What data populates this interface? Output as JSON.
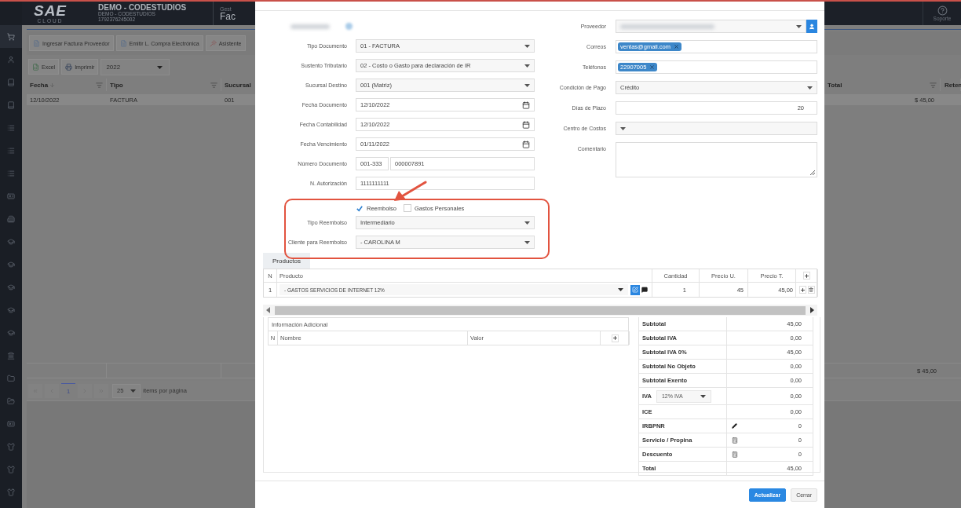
{
  "app": {
    "logo": "SAE",
    "logo_sub": "CLOUD",
    "company": "DEMO - CODESTUDIOS",
    "company_sub": "DEMO - CODESTUDIOS",
    "company_id": "1792376245002",
    "section": "Gest",
    "page_title": "Fac",
    "support": "Soporte"
  },
  "sidebar": {
    "items": [
      {
        "selected": true
      },
      {
        "selected": false
      },
      {
        "selected": false
      },
      {
        "selected": false
      },
      {
        "selected": false
      },
      {
        "selected": false
      },
      {
        "selected": false
      },
      {
        "selected": false
      },
      {
        "selected": false
      },
      {
        "selected": false
      },
      {
        "selected": false
      },
      {
        "selected": false
      },
      {
        "selected": false
      },
      {
        "selected": false
      },
      {
        "selected": false
      },
      {
        "selected": false
      },
      {
        "selected": false
      },
      {
        "selected": false
      },
      {
        "selected": false
      },
      {
        "selected": false
      },
      {
        "selected": false
      }
    ]
  },
  "actions": [
    "Ingresar Factura Proveedor",
    "Emitir L. Compra Electrónica",
    "Asistente"
  ],
  "list_tools": {
    "buttons": [
      "Excel",
      "Imprimir"
    ],
    "year": "2022"
  },
  "grid": {
    "columns": [
      {
        "label": "Fecha",
        "sorted": true
      },
      {
        "label": "Tipo",
        "sorted": false
      },
      {
        "label": "Sucursal",
        "sorted": false
      }
    ],
    "right_columns": [
      "Total",
      "Reten"
    ],
    "rows": [
      {
        "fecha": "12/10/2022",
        "tipo": "FACTURA",
        "sucursal": "001",
        "total": "$ 45,00"
      }
    ],
    "footer_total": "$ 45,00",
    "page": "1",
    "page_size": "25",
    "page_size_label": "ítems por página"
  },
  "form": {
    "left": [
      {
        "kind": "redacted"
      },
      {
        "label": "Tipo Documento",
        "kind": "select",
        "value": "01 - FACTURA"
      },
      {
        "label": "Sustento Tributario",
        "kind": "select",
        "value": "02 - Costo o Gasto para declaración de IR"
      },
      {
        "label": "Sucursal Destino",
        "kind": "select",
        "value": "001 (Matriz)"
      },
      {
        "label": "Fecha Documento",
        "kind": "date",
        "value": "12/10/2022"
      },
      {
        "label": "Fecha Contabilidad",
        "kind": "date",
        "value": "12/10/2022"
      },
      {
        "label": "Fecha Vencimiento",
        "kind": "date",
        "value": "01/11/2022"
      },
      {
        "label": "Número Documento",
        "kind": "split",
        "values": [
          "001-333",
          "000007891"
        ]
      },
      {
        "label": "N. Autorización",
        "kind": "text",
        "value": "1111111111"
      }
    ],
    "reembolso": {
      "checks": [
        {
          "label": "Reembolso",
          "checked": true
        },
        {
          "label": "Gastos Personales",
          "checked": false
        }
      ],
      "fields": [
        {
          "label": "Tipo Reembolso",
          "kind": "select",
          "value": "Intermediario"
        },
        {
          "label": "Cliente para Reembolso",
          "kind": "select",
          "value": "- CAROLINA M"
        }
      ]
    },
    "right": [
      {
        "label": "Proveedor",
        "kind": "redacted_select"
      },
      {
        "label": "Correos",
        "kind": "tags",
        "tags": [
          "ventas@gmail.com"
        ]
      },
      {
        "label": "Teléfonos",
        "kind": "tags",
        "tags": [
          "22907005"
        ]
      },
      {
        "label": "Condición de Pago",
        "kind": "select",
        "value": "Crédito"
      },
      {
        "label": "Días de Plazo",
        "kind": "number",
        "value": "20"
      },
      {
        "label": "Centro de Costos",
        "kind": "select"
      },
      {
        "label": "Comentario",
        "kind": "textarea"
      }
    ]
  },
  "products": {
    "tabs": [
      {
        "label": "Productos",
        "selected": true
      }
    ],
    "columns": [
      "N",
      "Producto",
      "Cantidad",
      "Precio U.",
      "Precio T."
    ],
    "rows": [
      {
        "n": "1",
        "product": "- GASTOS SERVICIOS DE INTERNET 12%",
        "qty": "1",
        "unit": "45",
        "total": "45,00"
      }
    ]
  },
  "info": {
    "title": "Información Adicional",
    "columns": [
      "N",
      "Nombre",
      "Valor"
    ]
  },
  "totals": [
    {
      "label": "Subtotal",
      "kind": "plain",
      "value": "45,00"
    },
    {
      "label": "Subtotal IVA",
      "kind": "plain",
      "value": "0,00"
    },
    {
      "label": "Subtotal IVA 0%",
      "kind": "plain",
      "value": "45,00"
    },
    {
      "label": "Subtotal No Objeto",
      "kind": "plain",
      "value": "0,00"
    },
    {
      "label": "Subtotal Exento",
      "kind": "plain",
      "value": "0,00"
    },
    {
      "label": "IVA",
      "kind": "select",
      "option": "12% IVA",
      "value": "0,00"
    },
    {
      "label": "ICE",
      "kind": "plain",
      "value": "0,00"
    },
    {
      "label": "IRBPNR",
      "kind": "edit",
      "value": "0"
    },
    {
      "label": "Servicio / Propina",
      "kind": "calc",
      "value": "0"
    },
    {
      "label": "Descuento",
      "kind": "calc",
      "value": "0"
    },
    {
      "label": "Total",
      "kind": "plain",
      "value": "45,00"
    }
  ],
  "buttons": [
    {
      "label": "Actualizar",
      "kind": "primary"
    },
    {
      "label": "Cerrar",
      "kind": "secondary"
    }
  ]
}
